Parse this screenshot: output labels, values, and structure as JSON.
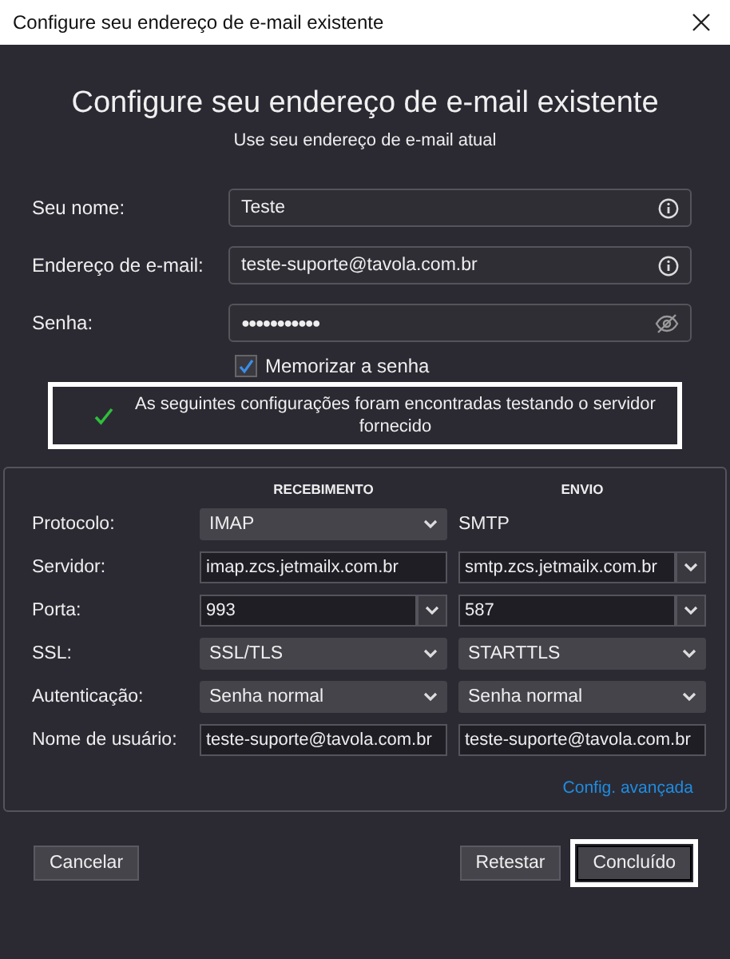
{
  "window": {
    "title": "Configure seu endereço de e-mail existente"
  },
  "heading": "Configure seu endereço de e-mail existente",
  "subheading": "Use seu endereço de e-mail atual",
  "fields": [
    {
      "label": "Seu nome:",
      "value": "Teste",
      "kind": "info"
    },
    {
      "label": "Endereço de e-mail:",
      "value": "teste-suporte@tavola.com.br",
      "kind": "info"
    },
    {
      "label": "Senha:",
      "value": "●●●●●●●●●●●",
      "kind": "password"
    }
  ],
  "remember": {
    "label": "Memorizar a senha",
    "checked": true
  },
  "status": {
    "message": "As seguintes configurações foram encontradas testando o servidor fornecido",
    "highlighted": true
  },
  "server_table": {
    "columns": [
      "RECEBIMENTO",
      "ENVIO"
    ],
    "rows": [
      {
        "label": "Protocolo:",
        "cells": [
          {
            "kind": "select",
            "value": "IMAP"
          },
          {
            "kind": "plain",
            "value": "SMTP"
          }
        ]
      },
      {
        "label": "Servidor:",
        "cells": [
          {
            "kind": "text",
            "value": "imap.zcs.jetmailx.com.br"
          },
          {
            "kind": "combo",
            "value": "smtp.zcs.jetmailx.com.br"
          }
        ]
      },
      {
        "label": "Porta:",
        "cells": [
          {
            "kind": "combo",
            "value": "993"
          },
          {
            "kind": "combo",
            "value": "587"
          }
        ]
      },
      {
        "label": "SSL:",
        "cells": [
          {
            "kind": "select",
            "value": "SSL/TLS"
          },
          {
            "kind": "select",
            "value": "STARTTLS"
          }
        ]
      },
      {
        "label": "Autenticação:",
        "cells": [
          {
            "kind": "select",
            "value": "Senha normal"
          },
          {
            "kind": "select",
            "value": "Senha normal"
          }
        ]
      },
      {
        "label": "Nome de usuário:",
        "cells": [
          {
            "kind": "text",
            "value": "teste-suporte@tavola.com.br"
          },
          {
            "kind": "text",
            "value": "teste-suporte@tavola.com.br"
          }
        ]
      }
    ],
    "advanced_link": "Config. avançada"
  },
  "buttons": [
    {
      "label": "Cancelar",
      "highlighted": false
    },
    {
      "label": "Retestar",
      "highlighted": false
    },
    {
      "label": "Concluído",
      "highlighted": true
    }
  ]
}
